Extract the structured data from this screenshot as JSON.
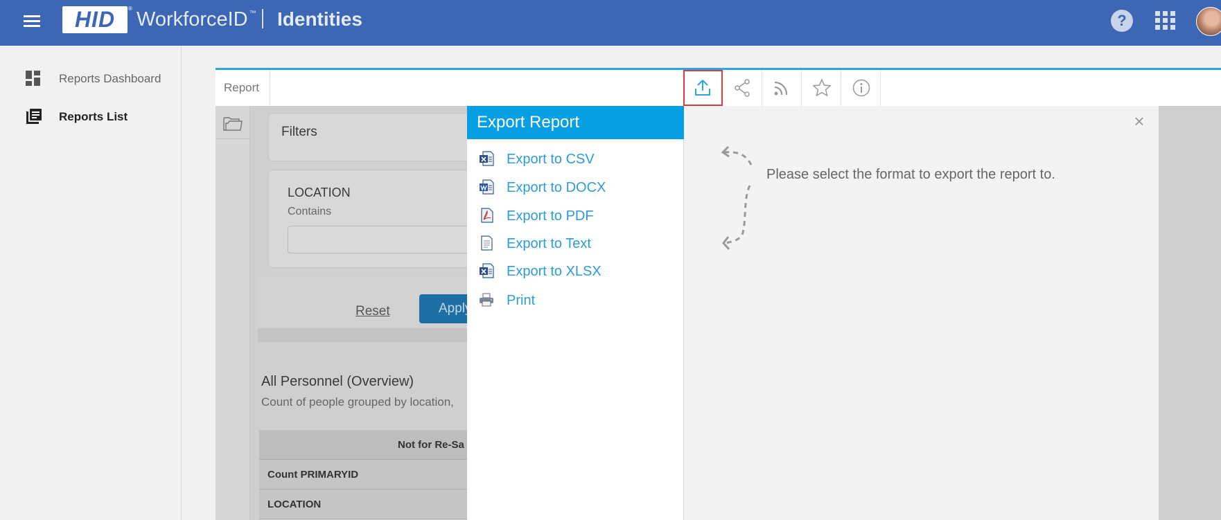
{
  "header": {
    "logo_text": "HID",
    "logo_reg": "®",
    "app_name": "WorkforceID",
    "tm": "™",
    "module": "Identities",
    "help_symbol": "?",
    "icons": [
      "menu-icon",
      "help-icon",
      "apps-grid-icon",
      "avatar"
    ],
    "color": "#3d67b5"
  },
  "sidebar": {
    "items": [
      {
        "label": "Reports Dashboard",
        "icon": "dashboard-icon"
      },
      {
        "label": "Reports List",
        "icon": "list-icon",
        "active": true
      }
    ]
  },
  "report": {
    "tab_label": "Report",
    "toolbar": [
      "export-icon",
      "share-icon",
      "rss-icon",
      "star-icon",
      "info-icon"
    ],
    "accent": "#2aa5e0",
    "filters_title": "Filters",
    "location": {
      "title": "LOCATION",
      "operator": "Contains",
      "value": ""
    },
    "reset_label": "Reset",
    "apply_label": "Apply",
    "title": "All Personnel (Overview)",
    "subtitle": "Count of people grouped by location,",
    "table": {
      "header": "Not for Re-Sa",
      "rows": [
        "Count PRIMARYID",
        "LOCATION"
      ]
    }
  },
  "export_modal": {
    "title": "Export Report",
    "header_color": "#069fe4",
    "items": [
      {
        "label": "Export to CSV",
        "icon": "csv-icon"
      },
      {
        "label": "Export to DOCX",
        "icon": "docx-icon"
      },
      {
        "label": "Export to PDF",
        "icon": "pdf-icon"
      },
      {
        "label": "Export to Text",
        "icon": "text-icon"
      },
      {
        "label": "Export to XLSX",
        "icon": "xlsx-icon"
      },
      {
        "label": "Print",
        "icon": "printer-icon"
      }
    ],
    "hint": "Please select the format to export the report to.",
    "close_symbol": "×"
  }
}
